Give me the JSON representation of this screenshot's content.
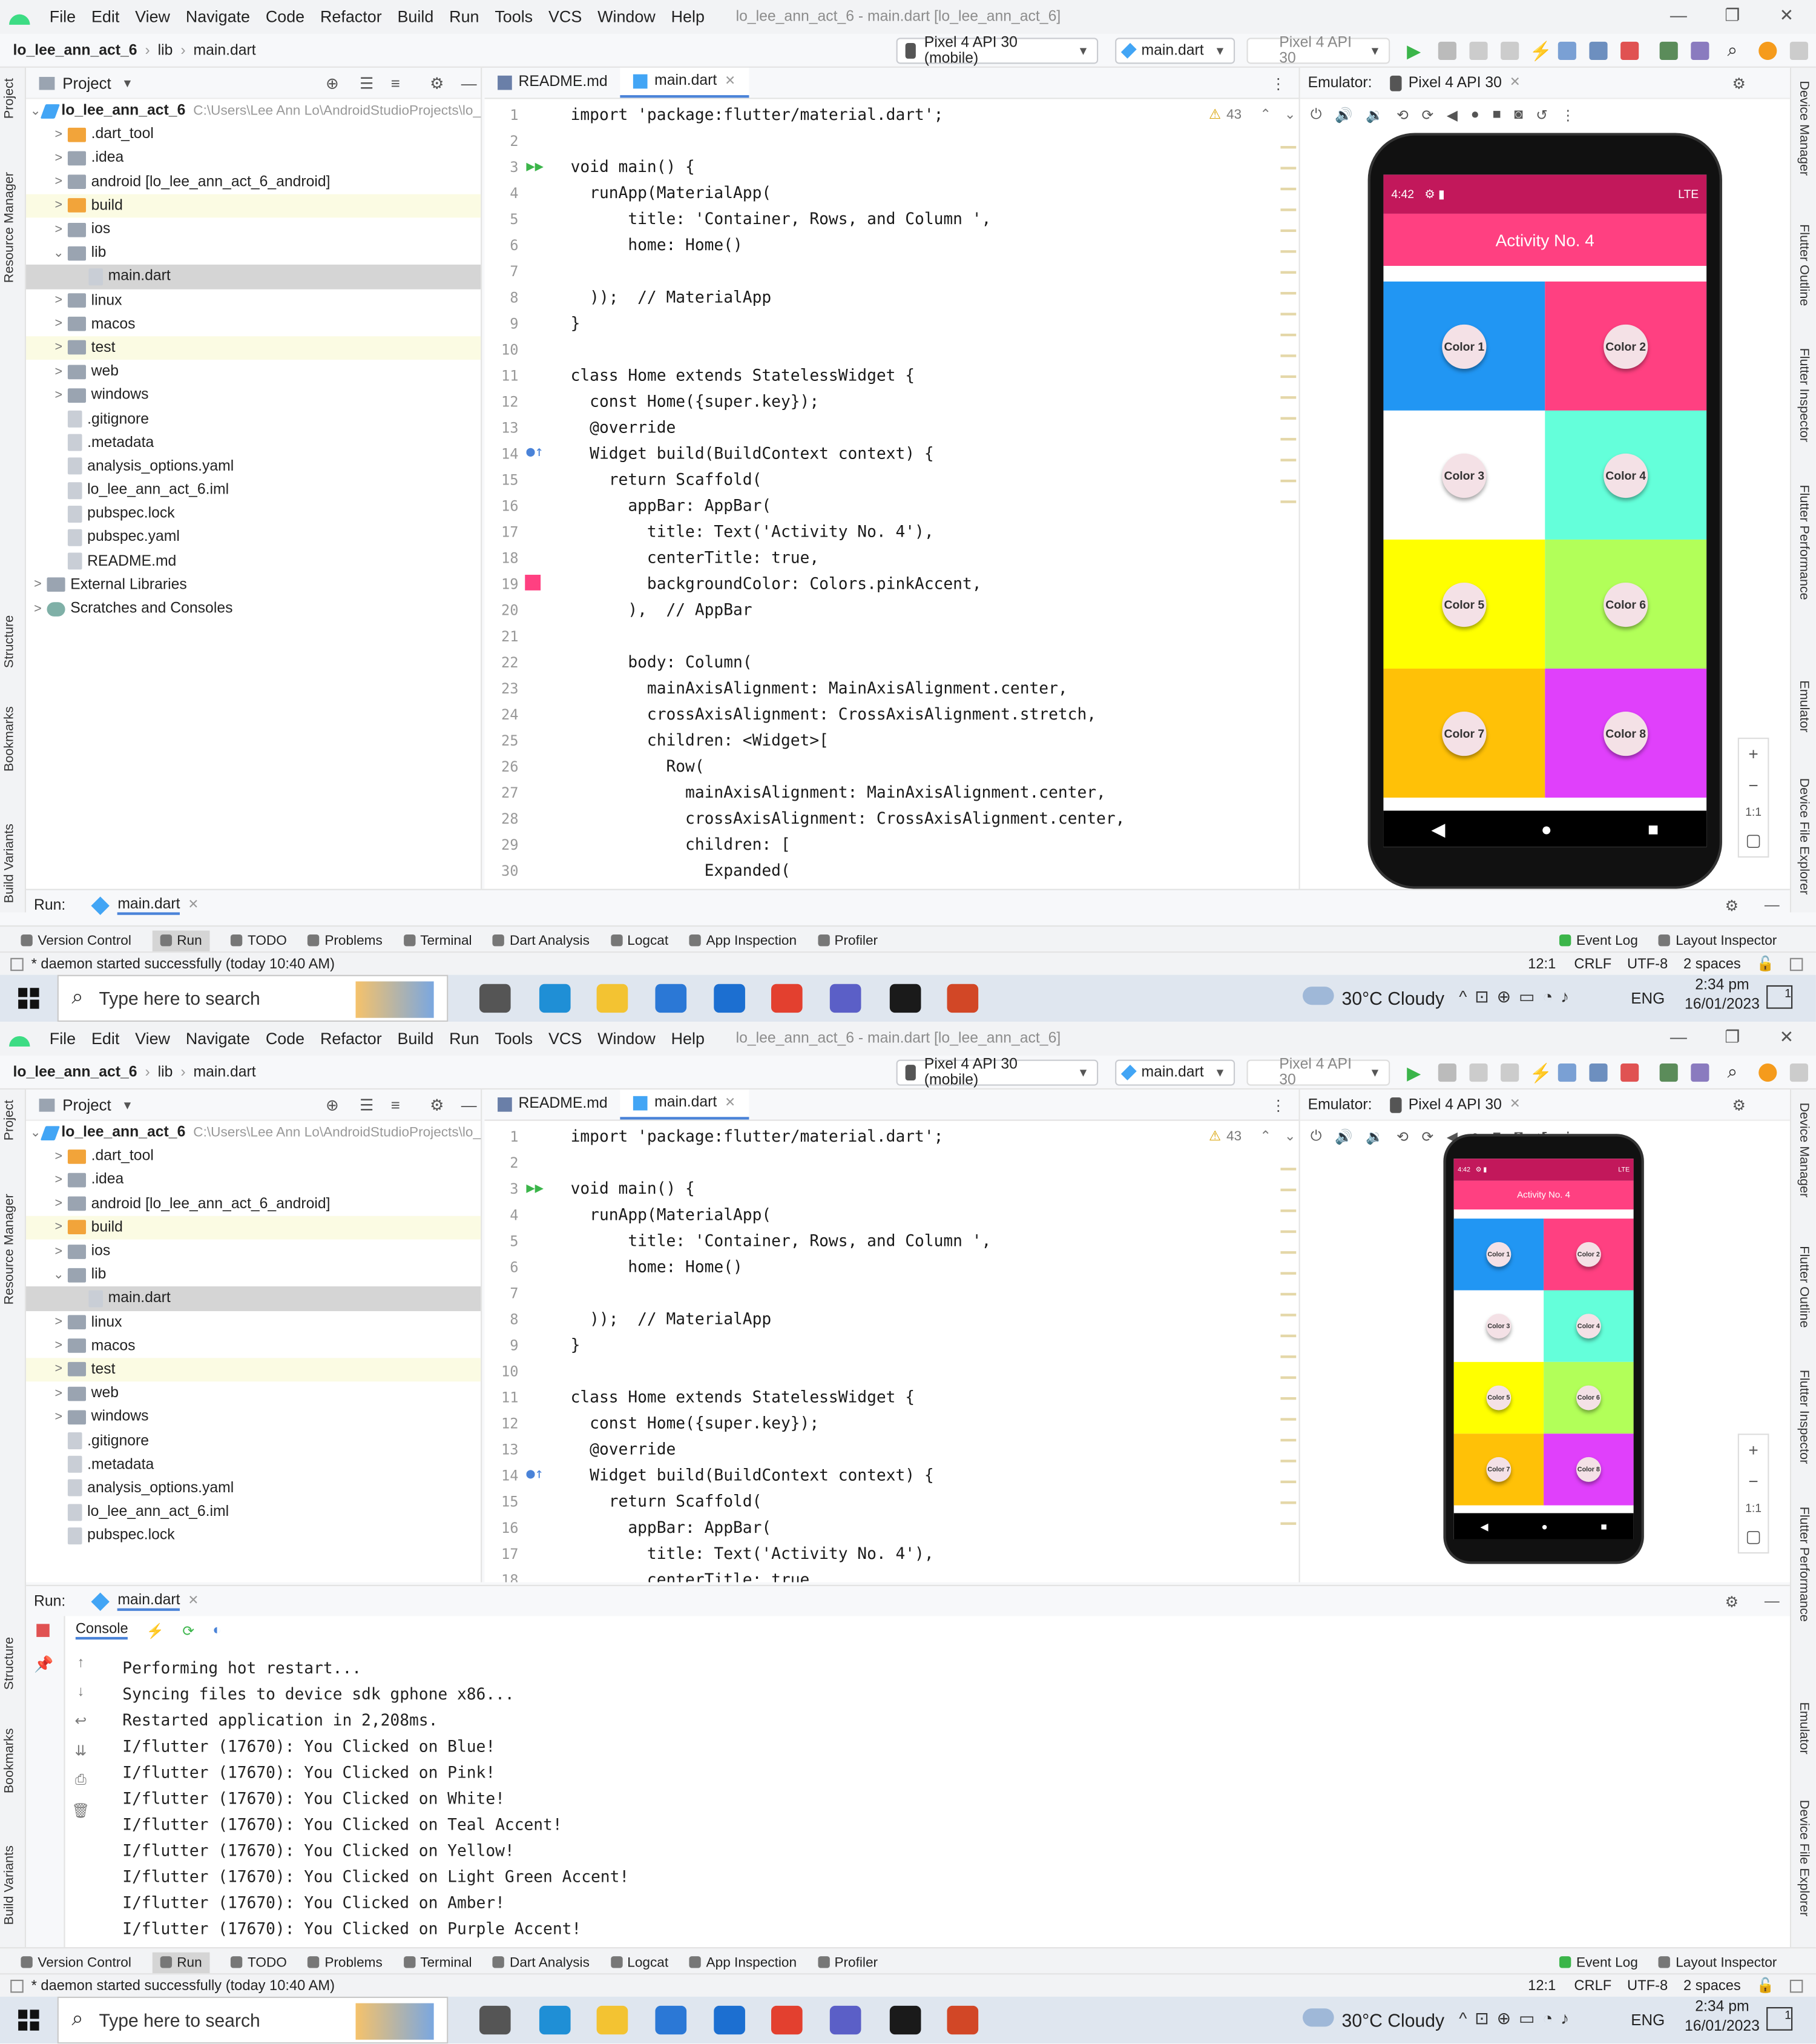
{
  "menu": [
    "File",
    "Edit",
    "View",
    "Navigate",
    "Code",
    "Refactor",
    "Build",
    "Run",
    "Tools",
    "VCS",
    "Window",
    "Help"
  ],
  "window_title": "lo_lee_ann_act_6 - main.dart [lo_lee_ann_act_6]",
  "breadcrumb": {
    "project": "lo_lee_ann_act_6",
    "folder": "lib",
    "file": "main.dart"
  },
  "toolbar": {
    "device": "Pixel 4 API 30 (mobile)",
    "config": "main.dart",
    "avd": "Pixel 4 API 30"
  },
  "project_panel": {
    "title": "Project",
    "root": "lo_lee_ann_act_6",
    "root_path": "C:\\Users\\Lee Ann Lo\\AndroidStudioProjects\\lo_",
    "items": [
      ".dart_tool",
      ".idea",
      "android [lo_lee_ann_act_6_android]",
      "build",
      "ios",
      "lib",
      "main.dart",
      "linux",
      "macos",
      "test",
      "web",
      "windows",
      ".gitignore",
      ".metadata",
      "analysis_options.yaml",
      "lo_lee_ann_act_6.iml",
      "pubspec.lock",
      "pubspec.yaml",
      "README.md"
    ],
    "external": "External Libraries",
    "scratches": "Scratches and Consoles"
  },
  "editor": {
    "tabs": [
      "README.md",
      "main.dart"
    ],
    "warnings": "43",
    "lines": [
      "import 'package:flutter/material.dart';",
      "",
      "void main() {",
      "  runApp(MaterialApp(",
      "      title: 'Container, Rows, and Column ',",
      "      home: Home()",
      "",
      "  ));  // MaterialApp",
      "}",
      "",
      "class Home extends StatelessWidget {",
      "  const Home({super.key});",
      "  @override",
      "  Widget build(BuildContext context) {",
      "    return Scaffold(",
      "      appBar: AppBar(",
      "        title: Text('Activity No. 4'),",
      "        centerTitle: true,",
      "        backgroundColor: Colors.pinkAccent,",
      "      ),  // AppBar",
      "",
      "      body: Column(",
      "        mainAxisAlignment: MainAxisAlignment.center,",
      "        crossAxisAlignment: CrossAxisAlignment.stretch,",
      "        children: <Widget>[",
      "          Row(",
      "            mainAxisAlignment: MainAxisAlignment.center,",
      "            crossAxisAlignment: CrossAxisAlignment.center,",
      "            children: [",
      "              Expanded("
    ]
  },
  "emulator": {
    "label": "Emulator:",
    "tab": "Pixel 4 API 30",
    "time": "4:42",
    "signal": "LTE",
    "app_title": "Activity No. 4",
    "buttons": [
      "Color 1",
      "Color 2",
      "Color 3",
      "Color 4",
      "Color 5",
      "Color 6",
      "Color 7",
      "Color 8"
    ],
    "zoom_label": "1:1"
  },
  "colors": {
    "pink_accent": "#ff4081",
    "blue": "#2196f3",
    "white": "#ffffff",
    "teal_accent": "#64ffda",
    "yellow": "#ffff00",
    "light_green_accent": "#b2ff59",
    "amber": "#ffc107",
    "purple_accent": "#e040fb"
  },
  "run": {
    "label": "Run:",
    "tab": "main.dart",
    "console_tab": "Console"
  },
  "console": [
    "Performing hot restart...",
    "Syncing files to device sdk gphone x86...",
    "Restarted application in 2,208ms.",
    "I/flutter (17670): You Clicked on Blue!",
    "I/flutter (17670): You Clicked on Pink!",
    "I/flutter (17670): You Clicked on White!",
    "I/flutter (17670): You Clicked on Teal Accent!",
    "I/flutter (17670): You Clicked on Yellow!",
    "I/flutter (17670): You Clicked on Light Green Accent!",
    "I/flutter (17670): You Clicked on Amber!",
    "I/flutter (17670): You Clicked on Purple Accent!"
  ],
  "bottom_tools": [
    "Version Control",
    "Run",
    "TODO",
    "Problems",
    "Terminal",
    "Dart Analysis",
    "Logcat",
    "App Inspection",
    "Profiler"
  ],
  "bottom_right": [
    "Event Log",
    "Layout Inspector"
  ],
  "status": {
    "message": "* daemon started successfully (today 10:40 AM)",
    "position": "12:1",
    "line_sep": "CRLF",
    "encoding": "UTF-8",
    "indent": "2 spaces"
  },
  "side_left": [
    "Project",
    "Resource Manager",
    "Structure",
    "Bookmarks",
    "Build Variants"
  ],
  "side_right": [
    "Device Manager",
    "Flutter Outline",
    "Flutter Inspector",
    "Flutter Performance",
    "Emulator",
    "Device File Explorer"
  ],
  "taskbar": {
    "search": "Type here to search",
    "weather": "30°C  Cloudy",
    "lang": "ENG",
    "time": "2:34 pm",
    "date": "16/01/2023",
    "notif": "1"
  }
}
